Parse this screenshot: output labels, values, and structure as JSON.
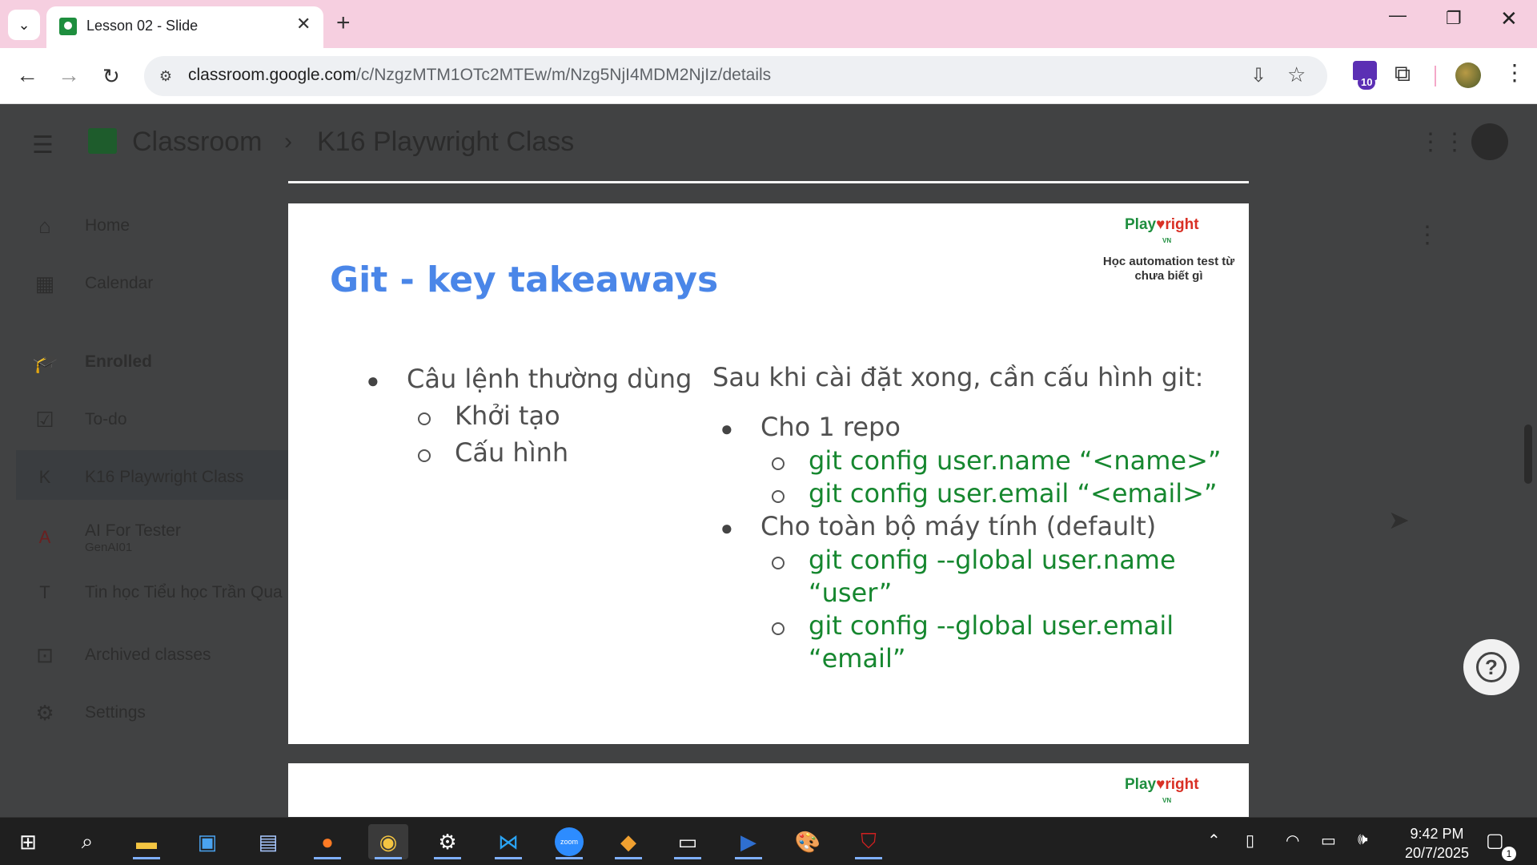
{
  "browser": {
    "tab_title": "Lesson 02 - Slide",
    "url_host": "classroom.google.com",
    "url_path": "/c/NzgzMTM1OTc2MTEw/m/Nzg5NjI4MDM2NjIz/details",
    "extension_badge": "10"
  },
  "classroom": {
    "app_title": "Classroom",
    "breadcrumb_separator": "›",
    "class_name": "K16 Playwright Class",
    "sidebar": [
      {
        "label": "Home",
        "icon": "home-icon"
      },
      {
        "label": "Calendar",
        "icon": "calendar-icon"
      },
      {
        "label": "Enrolled",
        "icon": "enrolled-icon"
      },
      {
        "label": "To-do",
        "icon": "todo-icon"
      },
      {
        "label": "K16 Playwright Class",
        "letter": "K",
        "letter_color": "#5a5a5a"
      },
      {
        "label": "AI For Tester",
        "sub": "GenAI01",
        "letter": "A",
        "letter_color": "#7a2a2a"
      },
      {
        "label": "Tin học Tiểu học Trần Qua",
        "letter": "T",
        "letter_color": "#5a5a5a"
      },
      {
        "label": "Archived classes",
        "icon": "archive-icon"
      },
      {
        "label": "Settings",
        "icon": "settings-icon"
      }
    ]
  },
  "slide": {
    "logo": {
      "play": "Play",
      "right": "right",
      "vn": "VN"
    },
    "tagline": "Học automation test từ chưa biết gì",
    "title": "Git - key takeaways",
    "left": {
      "heading": "Câu lệnh thường dùng",
      "items": [
        "Khởi tạo",
        "Cấu hình"
      ]
    },
    "right": {
      "intro": "Sau khi cài đặt xong, cần cấu hình git:",
      "groups": [
        {
          "heading": "Cho 1 repo",
          "lines": [
            "git config user.name “<name>”",
            "git config user.email “<email>”"
          ]
        },
        {
          "heading": "Cho toàn bộ máy tính (default)",
          "lines": [
            "git config --global user.name",
            "“user”",
            "git config --global user.email",
            "“email”"
          ]
        }
      ]
    }
  },
  "taskbar": {
    "time": "9:42 PM",
    "date": "20/7/2025",
    "notification_count": "1",
    "zoom_label": "zoom"
  }
}
